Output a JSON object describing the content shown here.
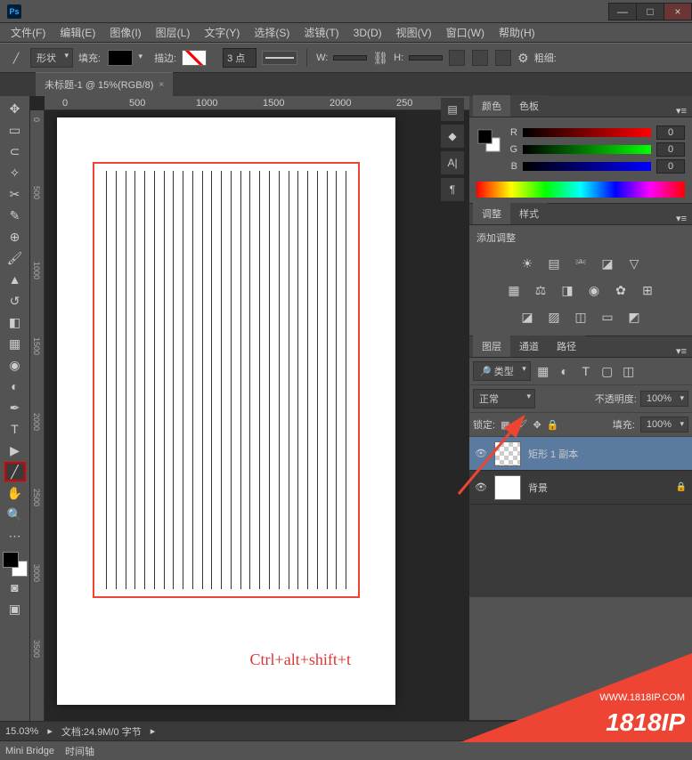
{
  "app": {
    "logo": "Ps"
  },
  "win": {
    "min": "—",
    "max": "□",
    "close": "×"
  },
  "menus": [
    "文件(F)",
    "编辑(E)",
    "图像(I)",
    "图层(L)",
    "文字(Y)",
    "选择(S)",
    "滤镜(T)",
    "3D(D)",
    "视图(V)",
    "窗口(W)",
    "帮助(H)"
  ],
  "options": {
    "shape_label": "形状",
    "fill_label": "填充:",
    "stroke_label": "描边:",
    "stroke_width": "3 点",
    "w_label": "W:",
    "h_label": "H:",
    "thick_label": "粗细:"
  },
  "doc_tab": {
    "title": "未标题-1 @ 15%(RGB/8)",
    "close": "×"
  },
  "ruler_h": [
    "0",
    "500",
    "1000",
    "1500",
    "2000",
    "250"
  ],
  "ruler_v": [
    "0",
    "500",
    "1000",
    "1500",
    "2000",
    "2500",
    "3000",
    "3500"
  ],
  "canvas": {
    "annotation": "Ctrl+alt+shift+t"
  },
  "color_panel": {
    "tabs": [
      "颜色",
      "色板"
    ],
    "r": {
      "label": "R",
      "value": "0"
    },
    "g": {
      "label": "G",
      "value": "0"
    },
    "b": {
      "label": "B",
      "value": "0"
    }
  },
  "adjust_panel": {
    "tabs": [
      "调整",
      "样式"
    ],
    "heading": "添加调整"
  },
  "layers_panel": {
    "tabs": [
      "图层",
      "通道",
      "路径"
    ],
    "kind": "🔎 类型",
    "mode": "正常",
    "opacity_label": "不透明度:",
    "opacity_value": "100%",
    "lock_label": "锁定:",
    "fill_label": "填充:",
    "fill_value": "100%",
    "layers": [
      {
        "name": "矩形 1 副本",
        "locked": false
      },
      {
        "name": "背景",
        "locked": true
      }
    ]
  },
  "status": {
    "zoom": "15.03%",
    "doc": "文档:24.9M/0 字节"
  },
  "bottom_tabs": [
    "Mini Bridge",
    "时间轴"
  ],
  "watermark": {
    "brand": "1818IP",
    "url": "WWW.1818IP.COM"
  }
}
